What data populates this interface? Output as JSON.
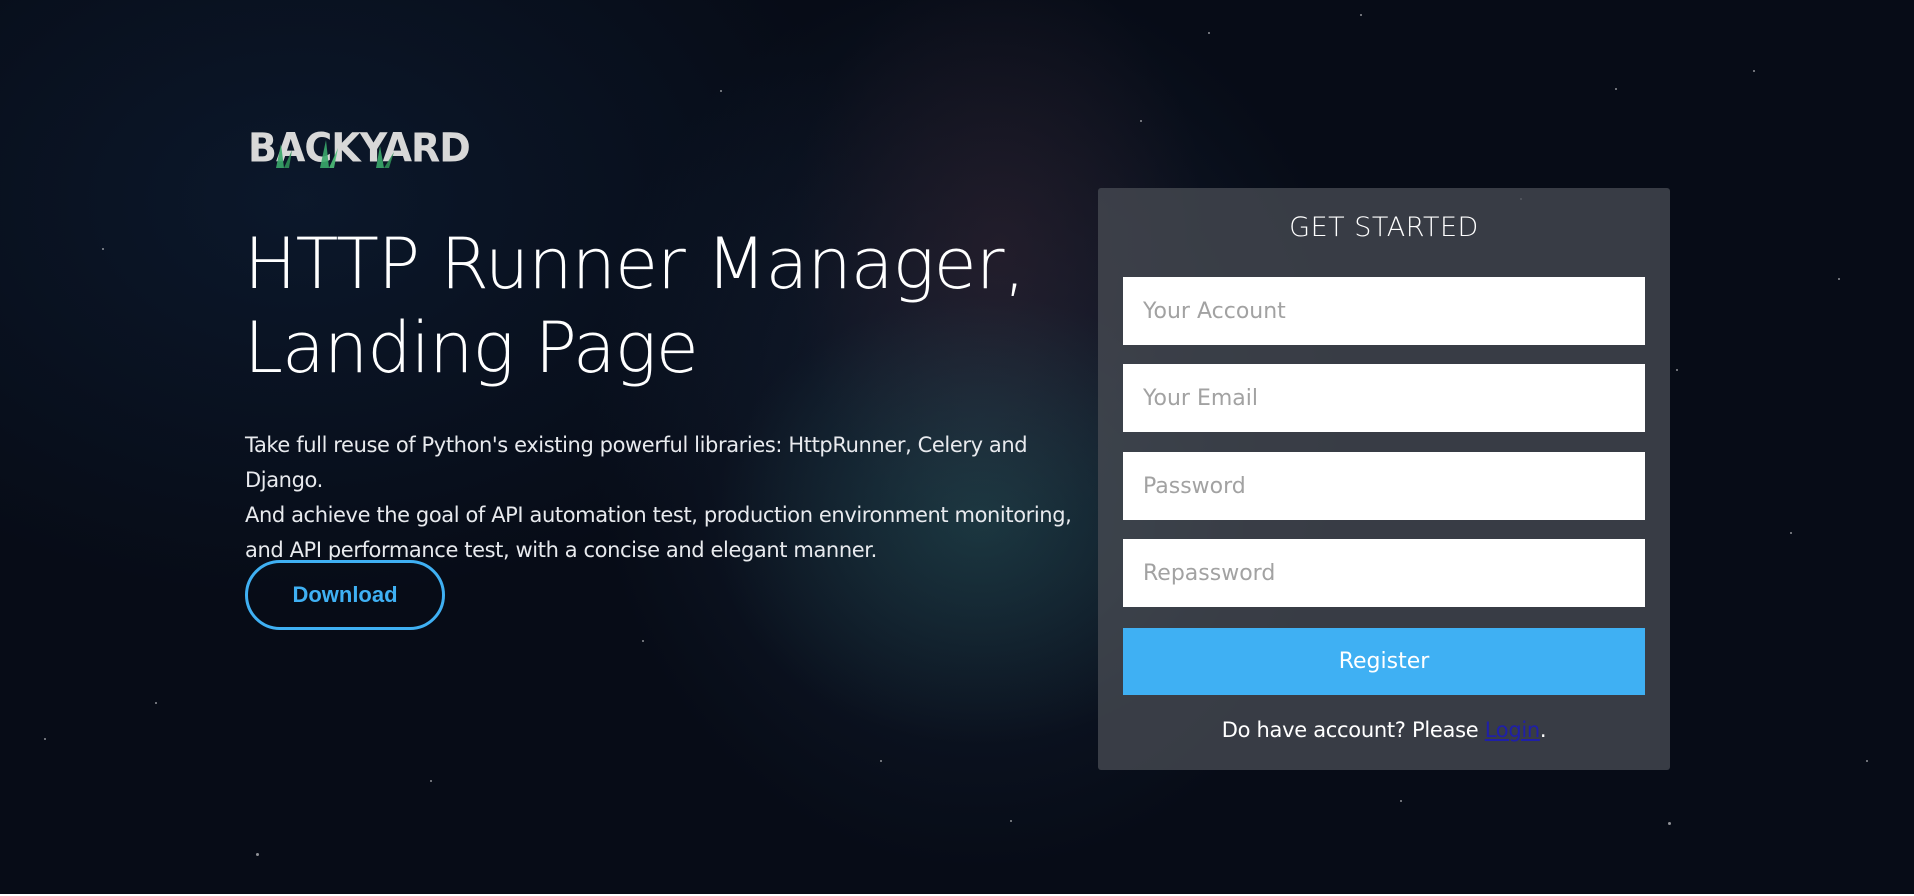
{
  "brand": {
    "logo_text": "BACKYARD"
  },
  "hero": {
    "headline_line1": "HTTP Runner Manager,",
    "headline_line2": "Landing Page",
    "description_line1": "Take full reuse of Python's existing powerful libraries: HttpRunner, Celery and Django.",
    "description_line2": "And achieve the goal of API automation test, production environment monitoring,",
    "description_line3": "and API performance test, with a concise and elegant manner.",
    "download_label": "Download"
  },
  "register_form": {
    "title": "GET STARTED",
    "account_placeholder": "Your Account",
    "email_placeholder": "Your Email",
    "password_placeholder": "Password",
    "repassword_placeholder": "Repassword",
    "register_label": "Register",
    "login_prompt": "Do have account? Please ",
    "login_link": "Login",
    "login_suffix": "."
  },
  "colors": {
    "accent": "#3fb0f3",
    "background": "#070c17",
    "card": "#464a52"
  }
}
